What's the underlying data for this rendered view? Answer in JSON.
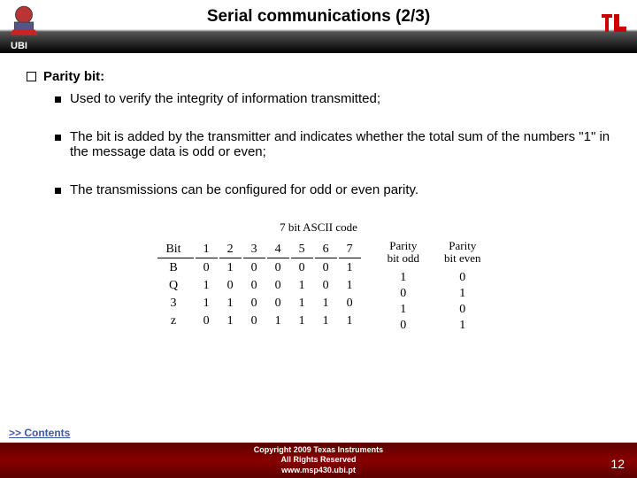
{
  "header": {
    "title": "Serial communications (2/3)",
    "ubi": "UBI"
  },
  "content": {
    "topic": "Parity bit:",
    "bullets": [
      "Used to verify the integrity of information transmitted;",
      "The bit is added by the transmitter and indicates whether the total sum of the numbers \"1\" in the message data is odd or even;",
      "The transmissions can be configured for odd or even parity."
    ]
  },
  "chart_data": {
    "type": "table",
    "title": "7 bit ASCII code",
    "bit_header": "Bit",
    "bit_numbers": [
      "1",
      "2",
      "3",
      "4",
      "5",
      "6",
      "7"
    ],
    "rows": [
      {
        "label": "B",
        "bits": [
          "0",
          "1",
          "0",
          "0",
          "0",
          "0",
          "1"
        ],
        "parity_odd": "1",
        "parity_even": "0"
      },
      {
        "label": "Q",
        "bits": [
          "1",
          "0",
          "0",
          "0",
          "1",
          "0",
          "1"
        ],
        "parity_odd": "0",
        "parity_even": "1"
      },
      {
        "label": "3",
        "bits": [
          "1",
          "1",
          "0",
          "0",
          "1",
          "1",
          "0"
        ],
        "parity_odd": "1",
        "parity_even": "0"
      },
      {
        "label": "z",
        "bits": [
          "0",
          "1",
          "0",
          "1",
          "1",
          "1",
          "1"
        ],
        "parity_odd": "0",
        "parity_even": "1"
      }
    ],
    "parity_odd_header": "Parity bit odd",
    "parity_even_header": "Parity bit even"
  },
  "footer": {
    "contents_link": ">> Contents",
    "copyright": "Copyright 2009 Texas Instruments",
    "rights": "All Rights Reserved",
    "url": "www.msp430.ubi.pt",
    "page": "12"
  }
}
